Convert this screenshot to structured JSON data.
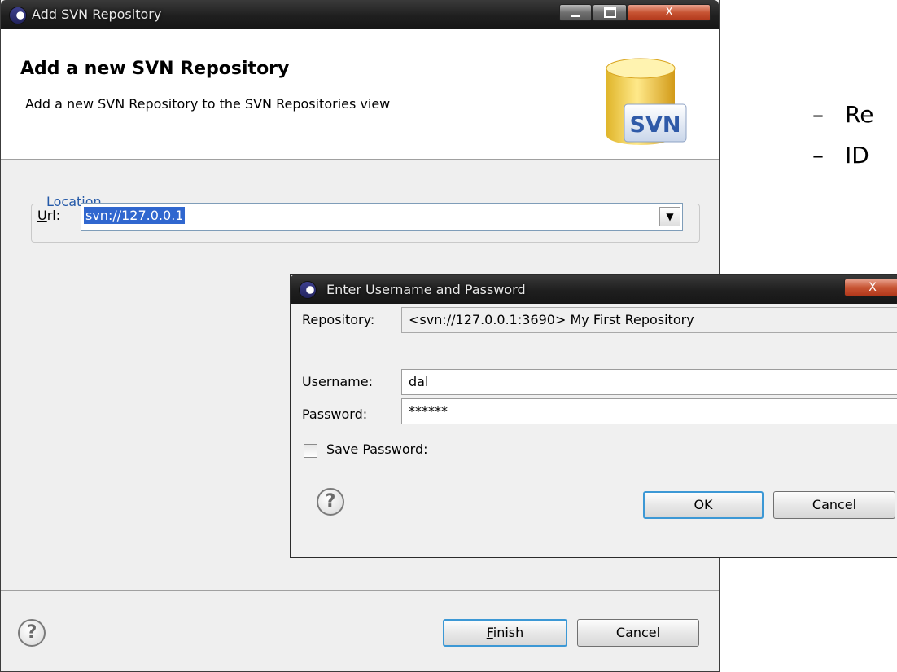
{
  "main_window": {
    "title": "Add SVN Repository",
    "close_glyph": "X",
    "header_title": "Add a new SVN Repository",
    "header_description": "Add a new SVN Repository to the SVN Repositories view",
    "banner_text": "SVN",
    "location_group": "Location",
    "url_label_mnemonic": "U",
    "url_label_rest": "rl:",
    "url_value": "svn://127.0.0.1",
    "finish_mnemonic": "F",
    "finish_rest": "inish",
    "cancel_label": "Cancel",
    "help_glyph": "?"
  },
  "slide_bullets": [
    {
      "dash": "–",
      "text": "Re"
    },
    {
      "dash": "–",
      "text": "ID"
    }
  ],
  "login_dialog": {
    "title": "Enter Username and Password",
    "close_glyph": "X",
    "repository_label": "Repository:",
    "repository_value": "<svn://127.0.0.1:3690> My First Repository",
    "username_label": "Username:",
    "username_value": "dal",
    "password_label": "Password:",
    "password_value": "******",
    "save_password_label": "Save Password:",
    "save_password_checked": false,
    "ok_label": "OK",
    "cancel_label": "Cancel",
    "help_glyph": "?"
  },
  "colors": {
    "titlebar": "#1f1f1f",
    "close_button": "#c75433",
    "selection": "#3067cf",
    "group_legend": "#2459a8",
    "default_button_border": "#3c98d5"
  },
  "icons": {
    "app": "eclipse-icon",
    "banner": "svn-repository-icon",
    "help": "help-icon",
    "dropdown": "chevron-down-icon"
  }
}
